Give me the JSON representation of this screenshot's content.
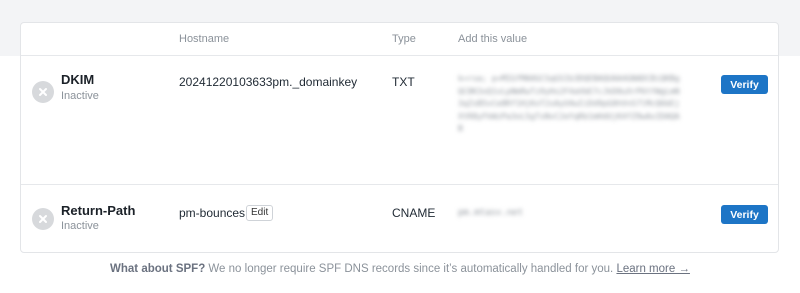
{
  "table": {
    "columns": {
      "hostname": "Hostname",
      "type": "Type",
      "value": "Add this value"
    },
    "rows": [
      {
        "name": "DKIM",
        "status": "Inactive",
        "hostname": "20241220103633pm._domainkey",
        "type": "TXT",
        "value": "k=rsa; p=MIGfMA0GCSqGSIb3DQEBAQUAA4GNADCBiQKBgQC8K3xQ1vLpNmRwTz9yHs2F4aVbE7cJkD0uXrP6tYWgLmN3qZsB5vCe8Rf1HjKoT2xAyU4wIiDd9pG0hVnS7lMcQ6bEjXtR8yFkWzPa3oL5gTsNvC2eYqRb1mHdUjK4fZ9wAxIDAQAB",
        "verify_label": "Verify"
      },
      {
        "name": "Return-Path",
        "status": "Inactive",
        "hostname": "pm-bounces",
        "edit_label": "Edit",
        "type": "CNAME",
        "value": "pm.mtasv.net",
        "verify_label": "Verify"
      }
    ]
  },
  "footer": {
    "question": "What about SPF?",
    "text": " We no longer require SPF DNS records since it’s automatically handled for you. ",
    "link": "Learn more →"
  },
  "icons": {
    "status": "x-circle-icon"
  },
  "colors": {
    "verify_button": "#1d75c6",
    "status_icon": "#d7d9dc"
  }
}
